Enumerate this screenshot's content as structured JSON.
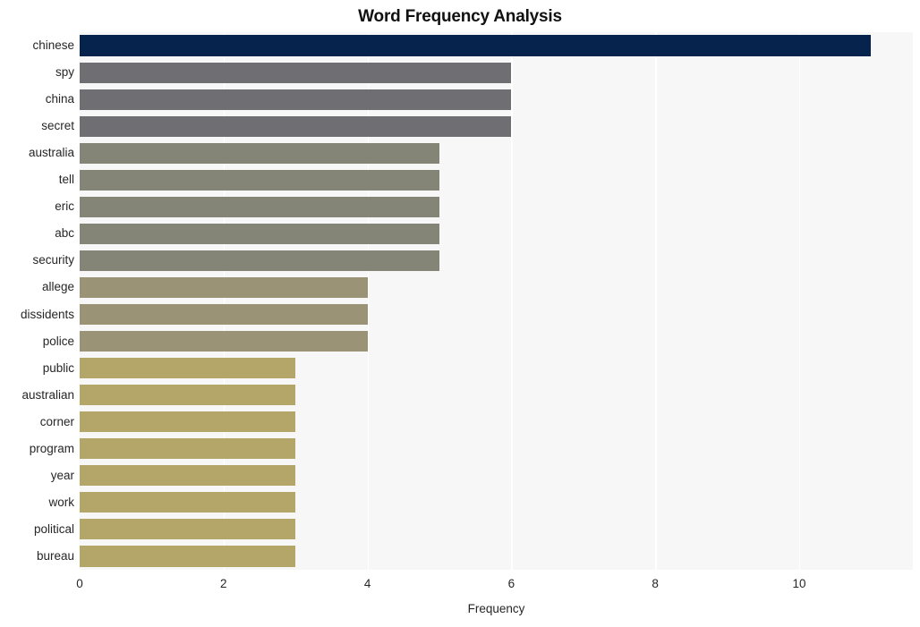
{
  "chart_data": {
    "type": "bar",
    "orientation": "horizontal",
    "title": "Word Frequency Analysis",
    "xlabel": "Frequency",
    "ylabel": "",
    "xlim": [
      0,
      11.58
    ],
    "xticks": [
      0,
      2,
      4,
      6,
      8,
      10
    ],
    "xtick_labels": [
      "0",
      "2",
      "4",
      "6",
      "8",
      "10"
    ],
    "grid": "vertical-white-on-light-gray",
    "legend": "none",
    "categories": [
      "chinese",
      "spy",
      "china",
      "secret",
      "australia",
      "tell",
      "eric",
      "abc",
      "security",
      "allege",
      "dissidents",
      "police",
      "public",
      "australian",
      "corner",
      "program",
      "year",
      "work",
      "political",
      "bureau"
    ],
    "values": [
      11,
      6,
      6,
      6,
      5,
      5,
      5,
      5,
      5,
      4,
      4,
      4,
      3,
      3,
      3,
      3,
      3,
      3,
      3,
      3
    ],
    "bar_colors": [
      "#06234d",
      "#6e6e73",
      "#6e6e73",
      "#6e6e73",
      "#858577",
      "#858577",
      "#858577",
      "#858577",
      "#858577",
      "#9b9375",
      "#9b9375",
      "#9b9375",
      "#b3a668",
      "#b3a668",
      "#b3a668",
      "#b3a668",
      "#b3a668",
      "#b3a668",
      "#b3a668",
      "#b3a668"
    ],
    "plot_background": "#f7f7f7",
    "figure_background": "#ffffff",
    "gridline_color": "#ffffff",
    "text_color": "#262626"
  }
}
